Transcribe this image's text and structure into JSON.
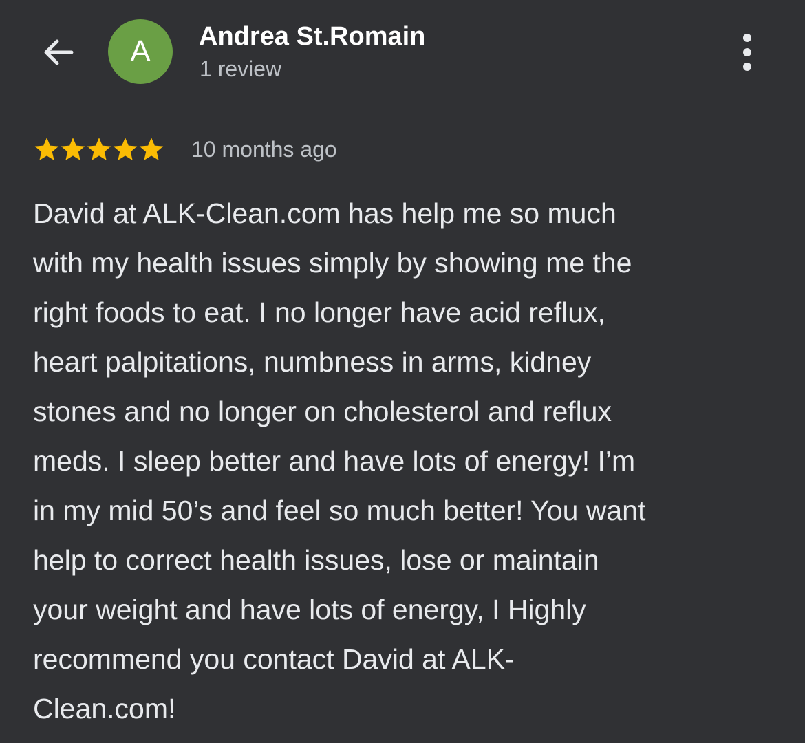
{
  "header": {
    "reviewer_name": "Andrea St.Romain",
    "review_count": "1 review",
    "avatar_letter": "A",
    "avatar_color": "#6a9f45",
    "back_icon": "arrow-back-icon",
    "more_icon": "more-vert-icon"
  },
  "review": {
    "rating": 5,
    "rating_max": 5,
    "star_color": "#fbbc04",
    "time": "10 months ago",
    "text_lines": [
      "David at ALK-Clean.com has help me so much",
      "with my health issues simply by showing me the",
      "right foods to eat. I no longer have acid reflux,",
      "heart palpitations, numbness in arms, kidney",
      "stones and no longer on cholesterol and reflux",
      "meds. I sleep better and have lots of energy! I’m",
      "in my mid 50’s and feel so much better! You want",
      "help to correct health issues, lose or maintain",
      "your weight and have lots of energy, I Highly",
      "recommend you contact David at ALK-",
      "Clean.com!"
    ]
  }
}
